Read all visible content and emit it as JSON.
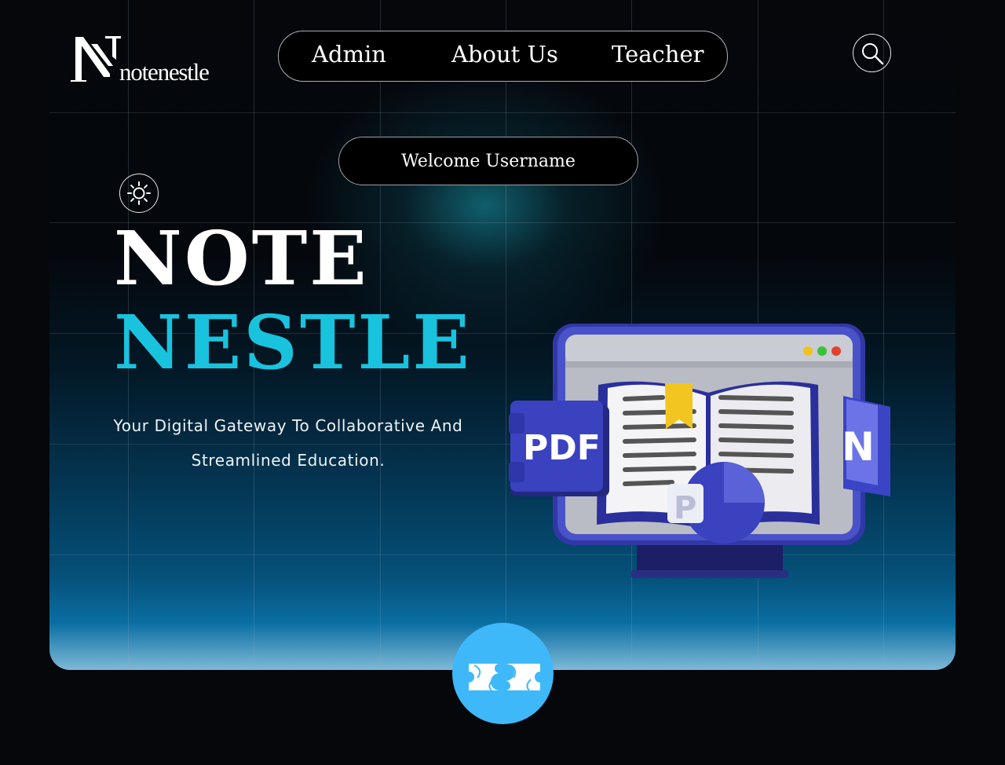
{
  "brand": {
    "name": "notenestle"
  },
  "nav": {
    "items": [
      {
        "label": "Admin"
      },
      {
        "label": "About Us"
      },
      {
        "label": "Teacher"
      }
    ]
  },
  "welcome": {
    "text": "Welcome Username"
  },
  "hero": {
    "title_line1": "NOTE",
    "title_line2": "NESTLE",
    "subtitle_line1": "Your Digital Gateway To Collaborative And",
    "subtitle_line2": "Streamlined Education."
  },
  "illustration": {
    "pdf_label": "PDF",
    "note_badge": "N",
    "slide_badge": "P"
  },
  "icons": {
    "search": "search-icon",
    "theme": "sun-icon",
    "floating": "ticket-icon"
  },
  "colors": {
    "accent": "#19c3de",
    "button": "#3fb8f9"
  }
}
